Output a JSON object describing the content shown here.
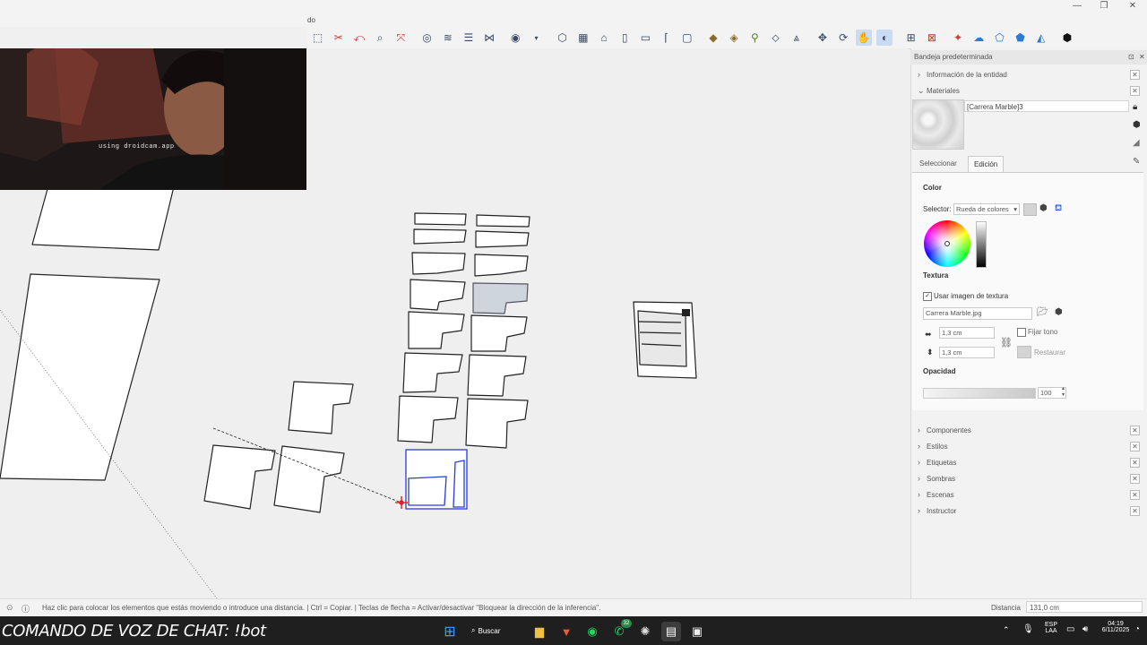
{
  "title_fragment": "do",
  "toolbar": {
    "icons": [
      "select-icon",
      "eraser-icon",
      "paint-icon",
      "orbit-icon",
      "zoom-icon",
      "zoom-extents-icon",
      "section-icon",
      "layers-icon",
      "stack-icon",
      "tag-icon",
      "user-icon",
      "dropdown-icon",
      "box-icon",
      "grid-icon",
      "house-icon",
      "door-icon",
      "window-icon",
      "roof-icon",
      "frame-icon",
      "crate-icon",
      "warehouse-icon",
      "pin-icon",
      "sandbox-icon",
      "terrain-icon",
      "move-icon",
      "rotate-icon",
      "orbit-active-icon",
      "walk-active-icon",
      "mesh-icon",
      "scene-icon",
      "fire-icon",
      "cloud-icon",
      "shape1-icon",
      "shape2-icon",
      "shape3-icon",
      "shape4-icon",
      "extension-icon"
    ]
  },
  "webcam": {
    "caption": "using droidcam.app"
  },
  "tray": {
    "title": "Bandeja predeterminada",
    "entity_info": "Información de la entidad",
    "materials": "Materiales",
    "material_name": "[Carrera Marble]3",
    "tab_select": "Seleccionar",
    "tab_edit": "Edición",
    "color_heading": "Color",
    "selector_label": "Selector:",
    "selector_value": "Rueda de colores",
    "texture_heading": "Textura",
    "use_texture_label": "Usar imagen de textura",
    "texture_file": "Carrera Marble.jpg",
    "width_value": "1,3 cm",
    "height_value": "1,3 cm",
    "fix_hue_label": "Fijar tono",
    "restore_label": "Restaurar",
    "opacity_heading": "Opacidad",
    "opacity_value": "100",
    "sections": [
      "Componentes",
      "Estilos",
      "Etiquetas",
      "Sombras",
      "Escenas",
      "Instructor"
    ]
  },
  "status": {
    "hint": "Haz clic para colocar los elementos que estás moviendo o introduce una distancia. | Ctrl = Copiar. | Teclas de flecha = Activar/desactivar \"Bloquear la dirección de la inferencia\".",
    "distance_label": "Distancia",
    "distance_value": "131,0 cm"
  },
  "taskbar": {
    "chat_command": "COMANDO DE VOZ DE CHAT: !bot",
    "search_label": "Buscar",
    "lang_line1": "ESP",
    "lang_line2": "LAA",
    "time": "04:19",
    "date": "6/11/2025",
    "notification_badge": "32"
  },
  "colors": {
    "selection_blue": "#2a3bd6",
    "inference_red": "#d22",
    "taskbar": "#1f1f1f"
  }
}
